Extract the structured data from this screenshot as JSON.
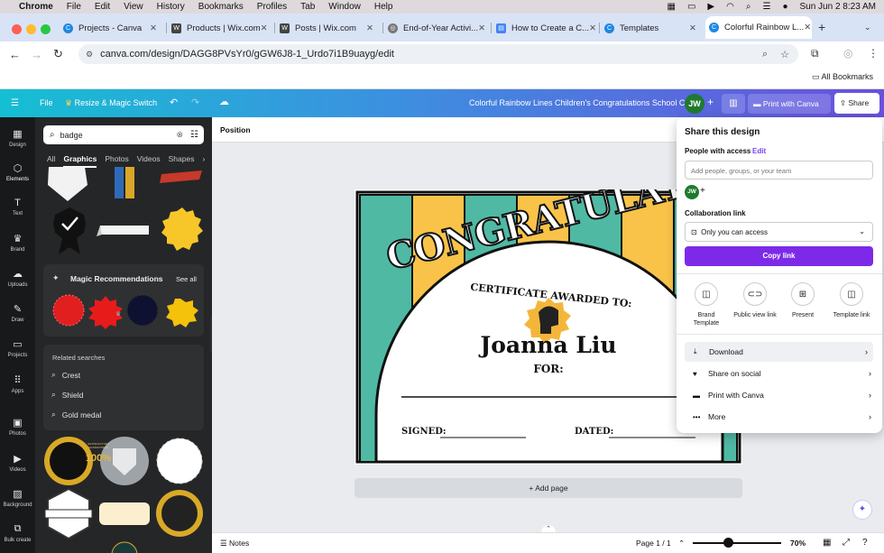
{
  "menubar": {
    "app": "Chrome",
    "items": [
      "File",
      "Edit",
      "View",
      "History",
      "Bookmarks",
      "Profiles",
      "Tab",
      "Window",
      "Help"
    ],
    "clock": "Sun Jun 2  8:23 AM"
  },
  "tabs": [
    {
      "title": "Projects - Canva",
      "icon": "C",
      "color": "#1e88e5"
    },
    {
      "title": "Products | Wix.com",
      "icon": "W",
      "color": "#444"
    },
    {
      "title": "Posts | Wix.com",
      "icon": "W",
      "color": "#444"
    },
    {
      "title": "End-of-Year Activi...",
      "icon": "◎",
      "color": "#777"
    },
    {
      "title": "How to Create a C...",
      "icon": "▤",
      "color": "#4285f4"
    },
    {
      "title": "Templates",
      "icon": "C",
      "color": "#1e88e5"
    },
    {
      "title": "Colorful Rainbow L...",
      "icon": "C",
      "color": "#1e88e5"
    }
  ],
  "browser": {
    "url": "canva.com/design/DAGG8PVsYr0/gGW6J8-1_Urdo7i1B9uayg/edit",
    "all_bookmarks": "All Bookmarks"
  },
  "canva_top": {
    "file": "File",
    "resize": "Resize & Magic Switch",
    "doc_title": "Colorful Rainbow Lines Children's Congratulations School C...",
    "avatar": "JW",
    "print": "Print with Canva",
    "share": "Share"
  },
  "rail": [
    {
      "label": "Design",
      "icon": "▦"
    },
    {
      "label": "Elements",
      "icon": "⬡"
    },
    {
      "label": "Text",
      "icon": "T"
    },
    {
      "label": "Brand",
      "icon": "♛"
    },
    {
      "label": "Uploads",
      "icon": "☁"
    },
    {
      "label": "Draw",
      "icon": "✎"
    },
    {
      "label": "Projects",
      "icon": "▭"
    },
    {
      "label": "Apps",
      "icon": "⠿"
    },
    {
      "label": "Photos",
      "icon": "▣"
    },
    {
      "label": "Videos",
      "icon": "▶"
    },
    {
      "label": "Background",
      "icon": "▨"
    },
    {
      "label": "Bulk create",
      "icon": "⧉"
    }
  ],
  "panel": {
    "search_value": "badge",
    "tabs": [
      "All",
      "Graphics",
      "Photos",
      "Videos",
      "Shapes"
    ],
    "magic_title": "Magic Recommendations",
    "see_all": "See all",
    "related_title": "Related searches",
    "related": [
      "Crest",
      "Shield",
      "Gold medal"
    ],
    "badge_text": "100%",
    "badge_ring": "SATISFACTION GUARANTEED"
  },
  "workspace": {
    "position": "Position",
    "add_page": "+ Add page",
    "notes": "Notes",
    "page": "Page 1 / 1",
    "zoom": "70%"
  },
  "certificate": {
    "heading": "CONGRATULATIONS",
    "awarded": "CERTIFICATE AWARDED TO:",
    "name": "Joanna Liu",
    "for": "FOR:",
    "signed": "SIGNED:",
    "dated": "DATED:",
    "colors": {
      "teal": "#4fb9a4",
      "gold": "#f8c348"
    }
  },
  "share": {
    "title": "Share this design",
    "people": "People with access",
    "edit": "Edit",
    "placeholder": "Add people, groups, or your team",
    "avatar": "JW",
    "collab": "Collaboration link",
    "access": "Only you can access",
    "copy": "Copy link",
    "options": [
      {
        "label": "Brand Template",
        "icon": "◫"
      },
      {
        "label": "Public view link",
        "icon": "⊂⊃"
      },
      {
        "label": "Present",
        "icon": "⊞"
      },
      {
        "label": "Template link",
        "icon": "◫"
      }
    ],
    "rows": [
      {
        "label": "Download",
        "icon": "⤓"
      },
      {
        "label": "Share on social",
        "icon": "♥"
      },
      {
        "label": "Print with Canva",
        "icon": "▬"
      },
      {
        "label": "More",
        "icon": "•••"
      }
    ]
  }
}
